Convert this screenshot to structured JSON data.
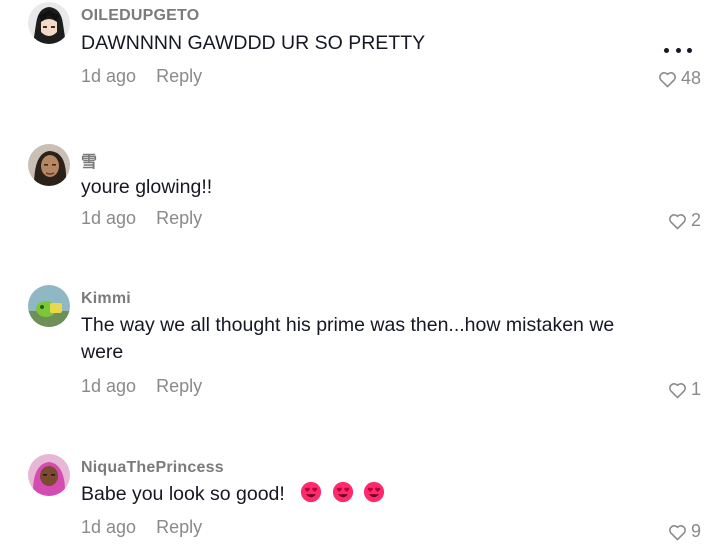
{
  "more_menu_icon": "ellipsis-icon",
  "like_icon": "heart-outline-icon",
  "comments": [
    {
      "username": "OILEDUPGETO",
      "text": "DAWNNNN GAWDDD UR SO PRETTY",
      "time": "1d ago",
      "reply_label": "Reply",
      "likes": "48",
      "avatar": "anime-character-avatar"
    },
    {
      "username": "雪",
      "text": "youre glowing!!",
      "time": "1d ago",
      "reply_label": "Reply",
      "likes": "2",
      "avatar": "person-selfie-avatar"
    },
    {
      "username": "Kimmi",
      "text": "The way we all thought his prime was then...how mistaken we were",
      "time": "1d ago",
      "reply_label": "Reply",
      "likes": "1",
      "avatar": "toy-figure-avatar"
    },
    {
      "username": "NiquaThePrincess",
      "text": "Babe you look so good!",
      "emoji": [
        "heart-eyes-emoji",
        "heart-eyes-emoji",
        "heart-eyes-emoji"
      ],
      "time": "1d ago",
      "reply_label": "Reply",
      "likes": "9",
      "avatar": "pink-hair-avatar"
    }
  ],
  "colors": {
    "text": "#161823",
    "secondary": "#8a8a8a",
    "emoji_face": "#ff2a6d"
  }
}
